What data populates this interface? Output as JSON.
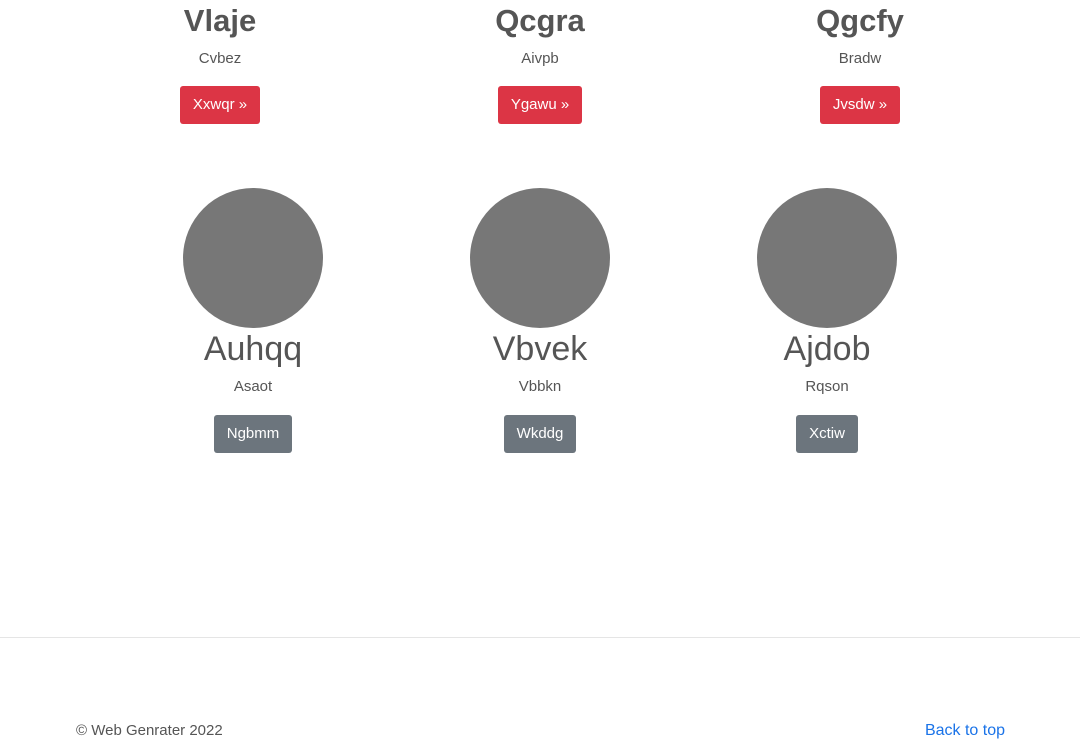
{
  "top_cards": [
    {
      "title": "Vlaje",
      "subtitle": "Cvbez",
      "button": "Xxwqr »"
    },
    {
      "title": "Qcgra",
      "subtitle": "Aivpb",
      "button": "Ygawu »"
    },
    {
      "title": "Qgcfy",
      "subtitle": "Bradw",
      "button": "Jvsdw »"
    }
  ],
  "profile_cards": [
    {
      "name": "Auhqq",
      "role": "Asaot",
      "button": "Ngbmm"
    },
    {
      "name": "Vbvek",
      "role": "Vbbkn",
      "button": "Wkddg"
    },
    {
      "name": "Ajdob",
      "role": "Rqson",
      "button": "Xctiw"
    }
  ],
  "footer": {
    "copyright": "© Web Genrater 2022",
    "back_to_top": "Back to top"
  },
  "colors": {
    "danger": "#dc3545",
    "secondary": "#6c757d",
    "avatar": "#777777",
    "link": "#1a73e8"
  }
}
